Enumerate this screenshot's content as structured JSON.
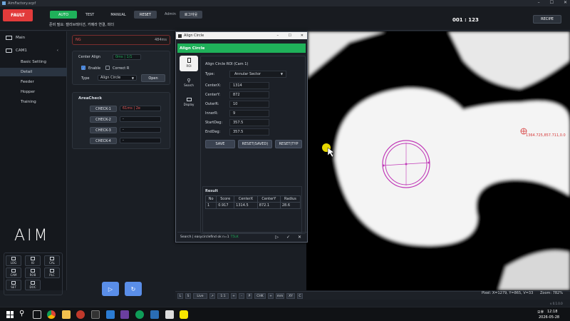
{
  "window": {
    "title": "AimFactory.scpf"
  },
  "header": {
    "fault_label": "FAULT",
    "auto_label": "AUTO",
    "test_label": "TEST",
    "manual_label": "MANUAL",
    "reset_label": "RESET",
    "user_role": "Admin",
    "logout_label": "로그아웃",
    "status_message": "준비 필요: 캘리브레이션, 카메라 연결, 피더",
    "counter": "001 : 123",
    "recipe_label": "RECIPE"
  },
  "nav": {
    "main": "Main",
    "cam": "CAM1",
    "items": [
      "Basic Setting",
      "Detail",
      "Feeder",
      "Hopper",
      "Training"
    ],
    "logo": "AIM",
    "tools": [
      "LOG",
      "IO",
      "CAL",
      "CAM",
      "ROB",
      "PLC",
      "SET",
      "DOC"
    ]
  },
  "panel": {
    "ng_label": "NG",
    "ng_time": "484ms",
    "center_align_label": "Center Align",
    "center_align_value": "0ms | 1/1",
    "enable_label": "Enable",
    "correct_label": "Correct R",
    "type_label": "Type",
    "type_value": "Align Circle",
    "open_label": "Open",
    "areacheck_title": "AreaCheck",
    "checks": [
      {
        "label": "CHECK-1",
        "value": "61ms | 2e"
      },
      {
        "label": "CHECK-2",
        "value": "-"
      },
      {
        "label": "CHECK-3",
        "value": "-"
      },
      {
        "label": "CHECK-4",
        "value": "-"
      }
    ]
  },
  "dialog": {
    "window_title": "Align Circle",
    "header": "Align Circle",
    "tabs": [
      "ROI",
      "Search",
      "Display"
    ],
    "roi_title": "Align Circle ROI (Cam 1)",
    "type_label": "Type:",
    "type_value": "Annular Sector",
    "fields": [
      {
        "label": "CenterX:",
        "value": "1314"
      },
      {
        "label": "CenterY:",
        "value": "872"
      },
      {
        "label": "OuterR:",
        "value": "10"
      },
      {
        "label": "InnerR:",
        "value": "9"
      },
      {
        "label": "StartDeg:",
        "value": "357.5"
      },
      {
        "label": "EndDeg:",
        "value": "357.5"
      }
    ],
    "buttons": [
      "SAVE",
      "RESET(SAVED)",
      "RESET(TYP"
    ],
    "result_title": "Result",
    "result_headers": [
      "No",
      "Score",
      "CenterX",
      "CenterY",
      "Radius"
    ],
    "result_row": [
      "1",
      "0.917",
      "1314.5",
      "872.1",
      "28.6"
    ],
    "status_text": "Search | easycirclefind ok n=1",
    "status_time": "T5LK"
  },
  "viewer": {
    "point_label": "1364.725,857.711,0.0",
    "pixel_info": "Pixel: X=1279, Y=865, V=33",
    "zoom_info": "Zoom: 782%"
  },
  "bottombar": [
    "L",
    "S",
    "Live",
    "↗",
    "1:1",
    "+",
    "-",
    "P",
    "CHK",
    "+",
    "mm",
    "XY",
    "C"
  ],
  "version": "v 0.1.0.0",
  "taskbar": {
    "time": "12:18",
    "ampm": "오후",
    "date": "2026-05-28"
  },
  "colors": {
    "accent": "#1fb15a",
    "fault": "#e23b3b",
    "roi": "#c13ab8"
  }
}
